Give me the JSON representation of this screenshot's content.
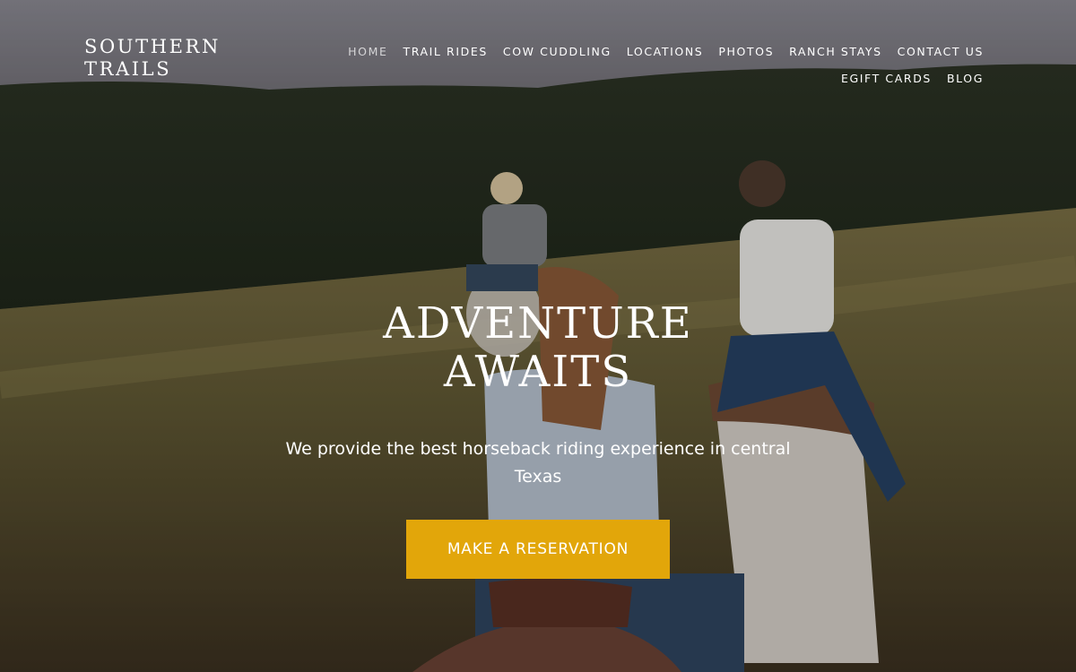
{
  "brand": {
    "line1": "SOUTHERN",
    "line2": "TRAILS"
  },
  "nav": {
    "row1": [
      {
        "label": "HOME",
        "active": true
      },
      {
        "label": "TRAIL RIDES"
      },
      {
        "label": "COW CUDDLING"
      },
      {
        "label": "LOCATIONS"
      },
      {
        "label": "PHOTOS"
      },
      {
        "label": "RANCH STAYS"
      },
      {
        "label": "CONTACT US"
      }
    ],
    "row2": [
      {
        "label": "EGIFT CARDS"
      },
      {
        "label": "BLOG"
      }
    ]
  },
  "hero": {
    "headline_line1": "ADVENTURE",
    "headline_line2": "AWAITS",
    "subtitle": "We provide the best horseback riding experience in central Texas",
    "cta_label": "MAKE A RESERVATION",
    "background_image": "three-riders-on-horses-in-field-photo"
  },
  "colors": {
    "cta": "#e2a60a",
    "text": "#ffffff"
  }
}
